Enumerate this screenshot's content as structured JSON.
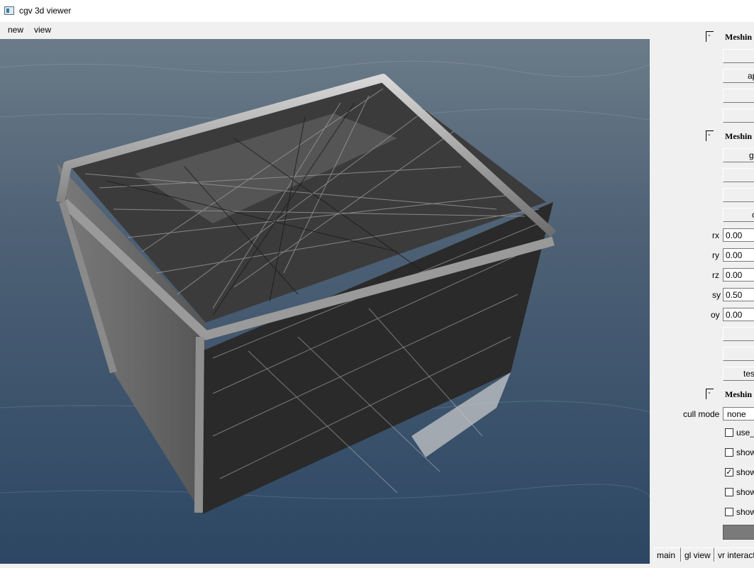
{
  "window": {
    "title": "cgv 3d viewer",
    "icon": "app-window-icon"
  },
  "menubar": {
    "items": [
      "new",
      "view"
    ]
  },
  "panel": {
    "groups": [
      {
        "toggle": "-",
        "label": "Meshin"
      },
      {
        "toggle": "-",
        "label": "Meshin"
      },
      {
        "toggle": "-",
        "label": "Meshin"
      }
    ],
    "group1_buttons": [
      "",
      "ap",
      "",
      ""
    ],
    "group2_buttons": [
      "g",
      "",
      "",
      "c"
    ],
    "fields": [
      {
        "label": "rx",
        "value": "0.00"
      },
      {
        "label": "ry",
        "value": "0.00"
      },
      {
        "label": "rz",
        "value": "0.00"
      },
      {
        "label": "sy",
        "value": "0.50"
      },
      {
        "label": "oy",
        "value": "0.00"
      }
    ],
    "group2_buttons_after": [
      "",
      "",
      "tes"
    ],
    "cull_mode": {
      "label": "cull mode",
      "value": "none"
    },
    "checkboxes": [
      {
        "label": "use_",
        "checked": false
      },
      {
        "label": "show",
        "checked": false
      },
      {
        "label": "show",
        "checked": true
      },
      {
        "label": "show",
        "checked": false
      },
      {
        "label": "show",
        "checked": false
      }
    ],
    "color_swatch": "#7a7a7a"
  },
  "tabs": [
    "main",
    "gl view",
    "vr interact"
  ]
}
